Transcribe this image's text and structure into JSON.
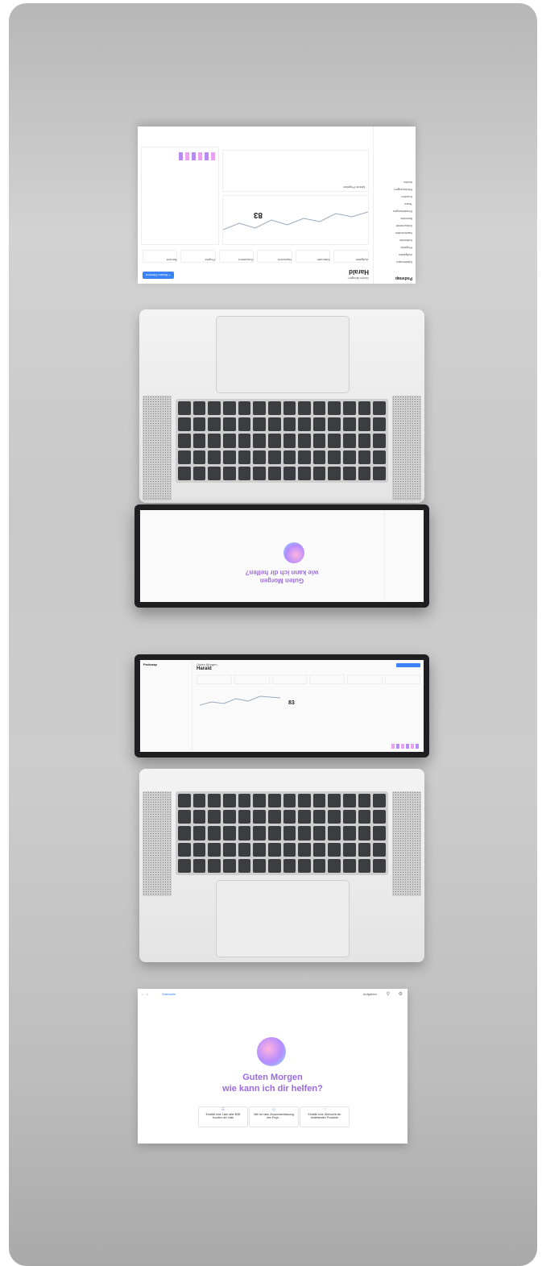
{
  "dashboard": {
    "logo": "Podsnap",
    "greeting": "Guten Morgen,",
    "user": "Harald",
    "new_button": "+ Neues Element",
    "quick_actions": [
      "Aufgabe",
      "Kalender",
      "Nachricht",
      "Dokument",
      "Projekt",
      "Bericht"
    ],
    "sidebar_items": [
      "Dashboard",
      "Aufgaben",
      "Projekte",
      "Kalender",
      "Nachrichten",
      "Dokumente",
      "Berichte",
      "Einstellungen",
      "Team",
      "Kunden",
      "Rechnungen",
      "Archiv"
    ],
    "kpi_value": "83",
    "section_title": "Meine Projekte"
  },
  "assistant": {
    "breadcrumb": "Startseite",
    "tasks_label": "Aufgaben",
    "greeting_line1": "Guten Morgen",
    "greeting_line2": "wie kann ich dir helfen?",
    "suggestions": [
      "Erstelle eine Liste aller B2B Kunden der Liste",
      "Wie ist mein Zusammenfassung des Proje...",
      "Erstelle eine Übersicht der beliebtesten Produkte"
    ]
  },
  "colors": {
    "accent": "#3b82f6",
    "purple": "#9b6ae0",
    "pink": "#e9a3f0"
  }
}
